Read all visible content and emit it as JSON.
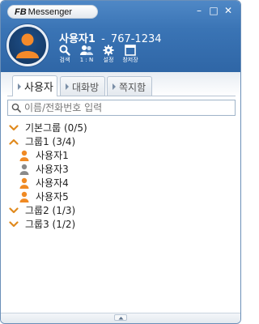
{
  "app": {
    "brand_prefix": "FB",
    "brand_name": "Messenger"
  },
  "window_controls": {
    "minimize": "–",
    "maximize": "□",
    "close": "✕"
  },
  "profile": {
    "name": "사용자1",
    "separator": "-",
    "phone": "767-1234"
  },
  "toolbar": [
    {
      "label": "검색",
      "icon": "search-icon"
    },
    {
      "label": "1 : N",
      "icon": "group-chat-icon"
    },
    {
      "label": "설정",
      "icon": "gear-icon"
    },
    {
      "label": "창저장",
      "icon": "window-save-icon"
    }
  ],
  "tabs": [
    {
      "label": "사용자",
      "active": true
    },
    {
      "label": "대화방",
      "active": false
    },
    {
      "label": "쪽지함",
      "active": false
    }
  ],
  "search": {
    "placeholder": "이름/전화번호 입력"
  },
  "tree": {
    "groups": [
      {
        "label": "기본그룹 (0/5)",
        "expanded": false
      },
      {
        "label": "그룹1 (3/4)",
        "expanded": true,
        "users": [
          {
            "label": "사용자1",
            "status": "online"
          },
          {
            "label": "사용자3",
            "status": "offline"
          },
          {
            "label": "사용자4",
            "status": "online"
          },
          {
            "label": "사용자5",
            "status": "online"
          }
        ]
      },
      {
        "label": "그룹2 (1/3)",
        "expanded": false
      },
      {
        "label": "그룹3 (1/2)",
        "expanded": false
      }
    ]
  },
  "colors": {
    "header": "#3a74b5",
    "online": "#f08a24",
    "offline": "#8a8a8a",
    "chevron": "#e08a1e"
  }
}
